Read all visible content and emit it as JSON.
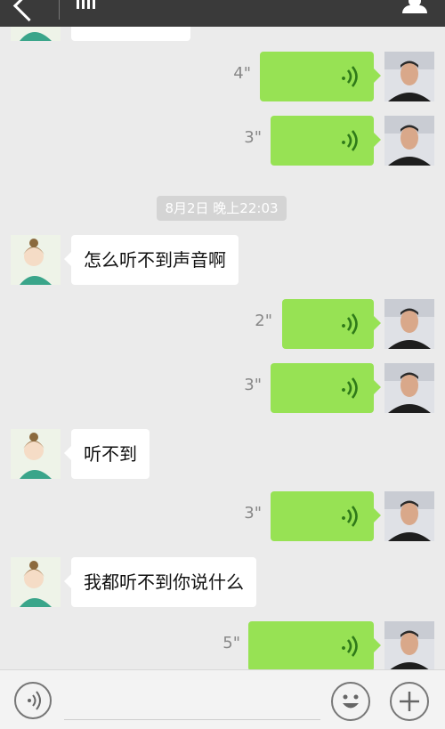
{
  "header": {
    "back_icon": "back-arrow-icon",
    "signal_icon": "signal-bars-icon",
    "contact_icon": "person-icon"
  },
  "colors": {
    "header_bg": "#3a3a3a",
    "chat_bg": "#ebebeb",
    "sent_bubble": "#97e254",
    "received_bubble": "#ffffff",
    "timestamp_bg": "#d4d4d4"
  },
  "messages": [
    {
      "side": "self",
      "type": "voice",
      "duration": "4\""
    },
    {
      "side": "self",
      "type": "voice",
      "duration": "3\""
    },
    {
      "type": "timestamp",
      "text": "8月2日 晚上22:03"
    },
    {
      "side": "other",
      "type": "text",
      "text": "怎么听不到声音啊"
    },
    {
      "side": "self",
      "type": "voice",
      "duration": "2\""
    },
    {
      "side": "self",
      "type": "voice",
      "duration": "3\""
    },
    {
      "side": "other",
      "type": "text",
      "text": "听不到"
    },
    {
      "side": "self",
      "type": "voice",
      "duration": "3\""
    },
    {
      "side": "other",
      "type": "text",
      "text": "我都听不到你说什么"
    },
    {
      "side": "self",
      "type": "voice",
      "duration": "5\""
    }
  ],
  "input_bar": {
    "voice_toggle_icon": "voice-mode-icon",
    "emoji_icon": "emoji-icon",
    "plus_icon": "plus-icon"
  }
}
